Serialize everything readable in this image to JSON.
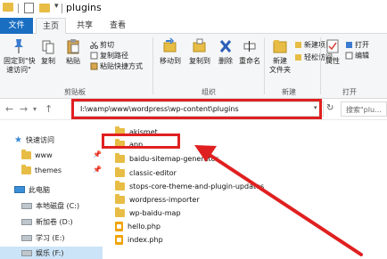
{
  "window": {
    "title": "plugins",
    "quick_access_chevron": "▾"
  },
  "ribbon_tabs": {
    "file": "文件",
    "home": "主页",
    "share": "共享",
    "view": "查看"
  },
  "ribbon": {
    "pin_quick_access": [
      "固定到\"快",
      "速访问\""
    ],
    "copy": "复制",
    "paste": "粘贴",
    "cut": "剪切",
    "copy_path": "复制路径",
    "paste_shortcut": "粘贴快捷方式",
    "clipboard_group": "剪贴板",
    "move_to": "移动到",
    "copy_to": "复制到",
    "delete": "删除",
    "rename": "重命名",
    "organize_group": "组织",
    "new_folder": [
      "新建",
      "文件夹"
    ],
    "new_item": "新建项目",
    "easy_access": "轻松访问",
    "new_group": "新建",
    "properties": "属性",
    "open_item": "打开",
    "edit_item": "编辑",
    "open_group": "打开"
  },
  "address_bar": {
    "path": "I:\\wamp\\www\\wordpress\\wp-content\\plugins",
    "dropdown": "▾",
    "search_placeholder": "搜索\"plu..."
  },
  "nav_pane": {
    "quick_access": "快速访问",
    "pinned_folders": [
      "www",
      "themes"
    ],
    "this_pc": "此电脑",
    "drives": [
      {
        "label": "本地磁盘 (C:)"
      },
      {
        "label": "新加卷 (D:)"
      },
      {
        "label": "学习 (E:)"
      },
      {
        "label": "娱乐 (F:)"
      }
    ]
  },
  "files": [
    {
      "name": "akismet",
      "type": "folder"
    },
    {
      "name": "app",
      "type": "folder"
    },
    {
      "name": "baidu-sitemap-generator",
      "type": "folder"
    },
    {
      "name": "classic-editor",
      "type": "folder"
    },
    {
      "name": "stops-core-theme-and-plugin-updates",
      "type": "folder"
    },
    {
      "name": "wordpress-importer",
      "type": "folder"
    },
    {
      "name": "wp-baidu-map",
      "type": "folder"
    },
    {
      "name": "hello.php",
      "type": "php"
    },
    {
      "name": "index.php",
      "type": "php"
    }
  ],
  "annotation_color": "#e02020"
}
